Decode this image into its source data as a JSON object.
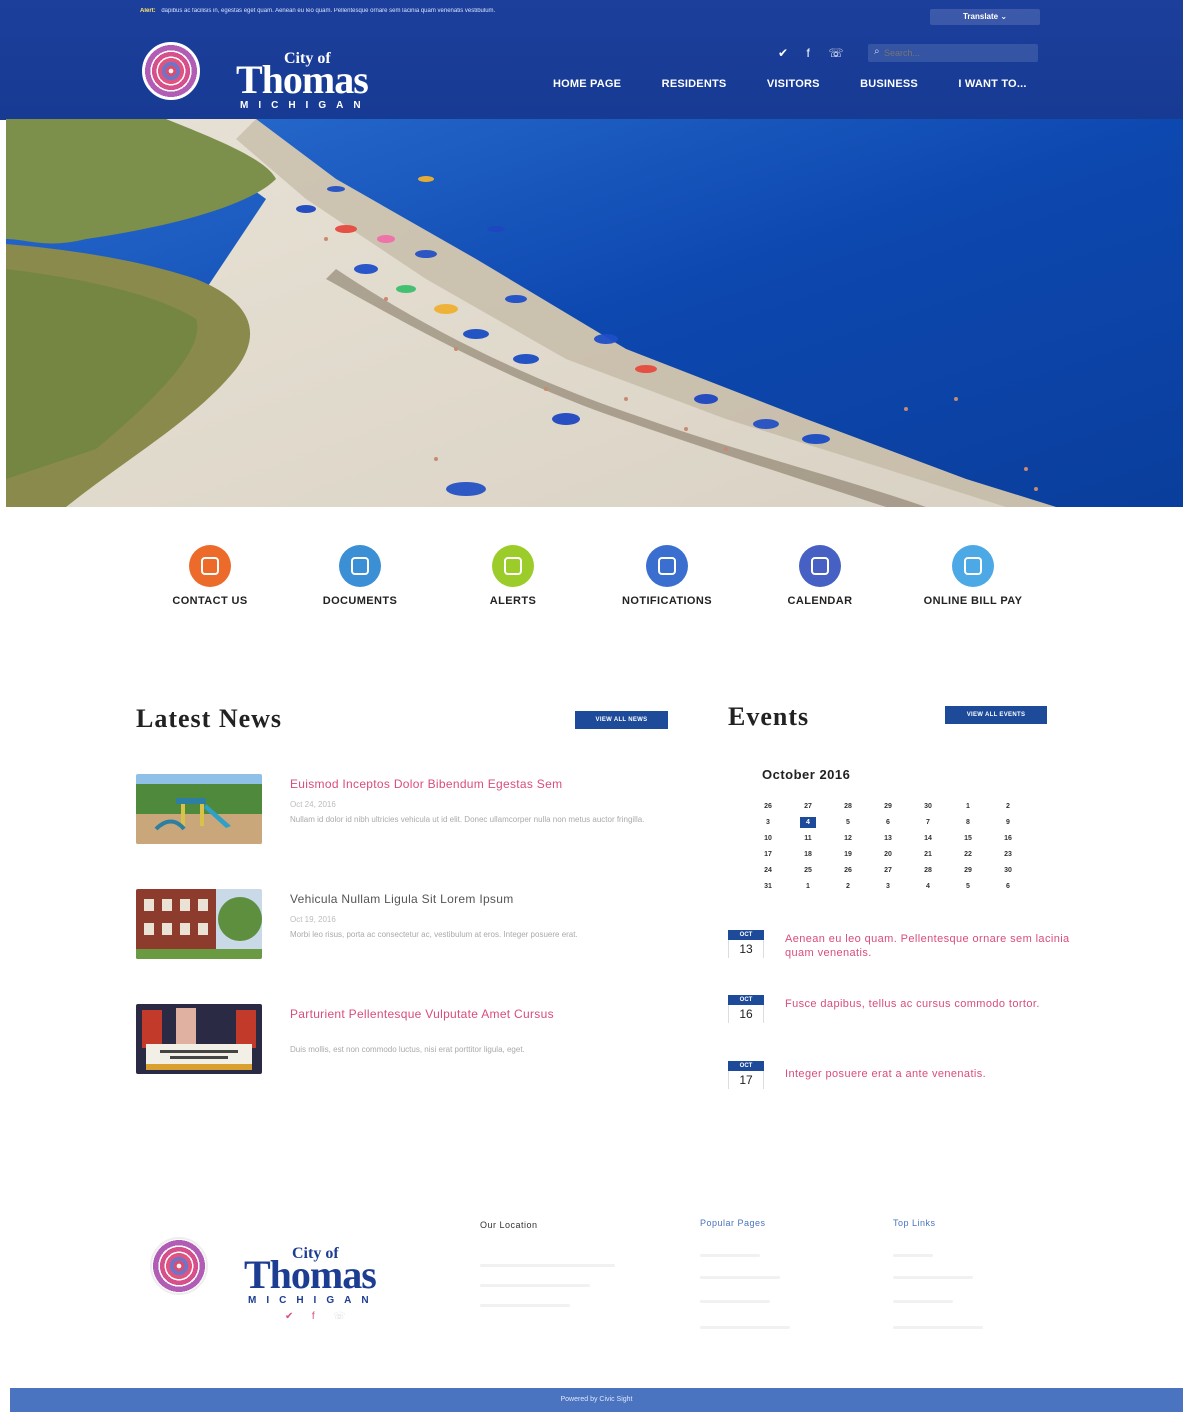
{
  "alert_bar": {
    "label": "Alert:",
    "text": "dapibus ac facilisis in, egestas eget quam. Aenean eu leo quam. Pellentesque ornare sem lacinia quam venenatis vestibulum.",
    "translate_label": "Translate ⌄"
  },
  "logo": {
    "line1": "City of",
    "line2": "Thomas",
    "line3": "MICHIGAN"
  },
  "social": {
    "twitter": "✔",
    "facebook": "f",
    "rss": "☏"
  },
  "search": {
    "placeholder": "Search..."
  },
  "nav": [
    "HOME PAGE",
    "RESIDENTS",
    "VISITORS",
    "BUSINESS",
    "I WANT TO..."
  ],
  "quick_links": [
    {
      "label": "CONTACT US",
      "color": "#ec6a2a",
      "icon": "phone-icon"
    },
    {
      "label": "DOCUMENTS",
      "color": "#3a8fd5",
      "icon": "document-icon"
    },
    {
      "label": "ALERTS",
      "color": "#9ccc2a",
      "icon": "bell-icon"
    },
    {
      "label": "NOTIFICATIONS",
      "color": "#3a6fd0",
      "icon": "notification-icon"
    },
    {
      "label": "CALENDAR",
      "color": "#4660c4",
      "icon": "calendar-icon"
    },
    {
      "label": "ONLINE BILL PAY",
      "color": "#4da8e6",
      "icon": "card-icon"
    }
  ],
  "news": {
    "title": "Latest News",
    "view_all": "VIEW ALL NEWS",
    "items": [
      {
        "headline": "Euismod Inceptos Dolor Bibendum Egestas Sem",
        "date": "Oct 24, 2016",
        "summary": "Nullam id dolor id nibh ultricies vehicula ut id elit. Donec ullamcorper nulla non metus auctor fringilla.",
        "accent": "#d94d79"
      },
      {
        "headline": "Vehicula Nullam Ligula Sit Lorem Ipsum",
        "date": "Oct 19, 2016",
        "summary": "Morbi leo risus, porta ac consectetur ac, vestibulum at eros. Integer posuere erat.",
        "accent": "#555555"
      },
      {
        "headline": "Parturient Pellentesque Vulputate Amet Cursus",
        "date": "",
        "summary": "Duis mollis, est non commodo luctus, nisi erat porttitor ligula, eget.",
        "accent": "#d94d79"
      }
    ]
  },
  "events": {
    "title": "Events",
    "view_all": "VIEW ALL EVENTS",
    "month": "October 2016",
    "calendar_rows": [
      [
        "26",
        "27",
        "28",
        "29",
        "30",
        "1",
        "2"
      ],
      [
        "3",
        "4",
        "5",
        "6",
        "7",
        "8",
        "9"
      ],
      [
        "10",
        "11",
        "12",
        "13",
        "14",
        "15",
        "16"
      ],
      [
        "17",
        "18",
        "19",
        "20",
        "21",
        "22",
        "23"
      ],
      [
        "24",
        "25",
        "26",
        "27",
        "28",
        "29",
        "30"
      ],
      [
        "31",
        "1",
        "2",
        "3",
        "4",
        "5",
        "6"
      ]
    ],
    "today": "4",
    "items": [
      {
        "month": "OCT",
        "day": "13",
        "text": "Aenean eu leo quam. Pellentesque ornare sem lacinia quam venenatis."
      },
      {
        "month": "OCT",
        "day": "16",
        "text": "Fusce dapibus, tellus ac cursus commodo tortor."
      },
      {
        "month": "OCT",
        "day": "17",
        "text": "Integer posuere erat a ante venenatis."
      }
    ]
  },
  "footer": {
    "location_title": "Our Location",
    "popular_title": "Popular Pages",
    "top_links_title": "Top Links",
    "social": {
      "twitter": "✔",
      "facebook": "f",
      "rss": "☏"
    },
    "powered": "Powered by Civic Sight"
  }
}
